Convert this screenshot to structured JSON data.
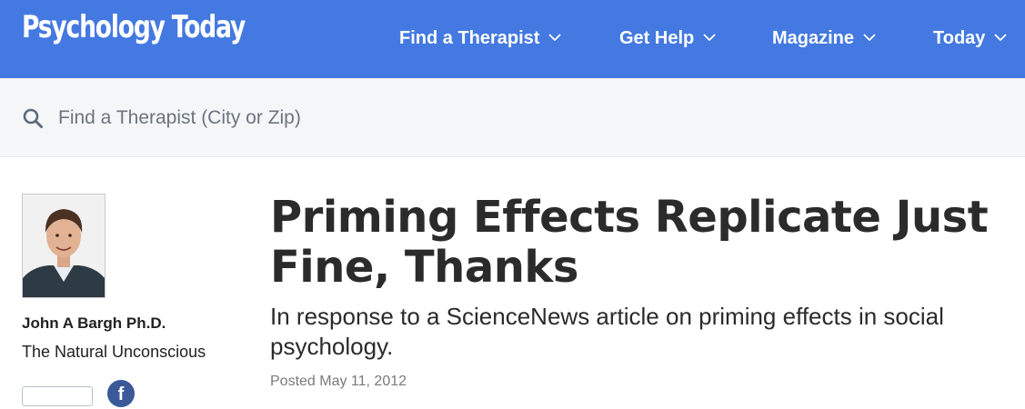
{
  "header": {
    "logo_text": "Psychology Today",
    "nav": [
      {
        "label": "Find a Therapist"
      },
      {
        "label": "Get Help"
      },
      {
        "label": "Magazine"
      },
      {
        "label": "Today"
      }
    ],
    "colors": {
      "bar": "#4479e1",
      "text": "#ffffff"
    }
  },
  "search": {
    "placeholder": "Find a Therapist (City or Zip)",
    "value": "",
    "icon": "search-icon"
  },
  "author": {
    "name": "John A Bargh Ph.D.",
    "blog": "The Natural Unconscious",
    "photo_icon": "author-photo"
  },
  "article": {
    "title": "Priming Effects Replicate Just Fine, Thanks",
    "subtitle": "In response to a ScienceNews article on priming effects in social psychology.",
    "posted": "Posted May 11, 2012"
  },
  "share": {
    "facebook_glyph": "f",
    "facebook_color": "#3b5998"
  }
}
